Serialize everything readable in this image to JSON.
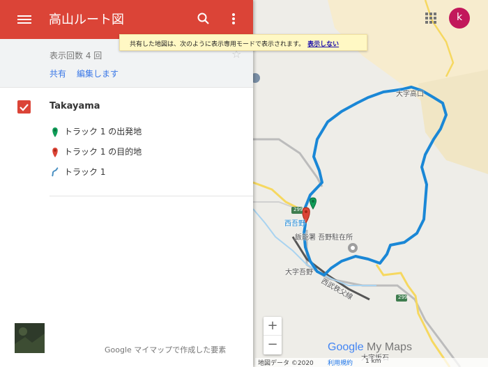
{
  "header": {
    "title": "高山ルート図",
    "menu_icon": "menu-icon",
    "search_icon": "search-icon",
    "more_icon": "more-vert-icon"
  },
  "info": {
    "views": "表示回数 4 回",
    "share_label": "共有",
    "edit_label": "編集します"
  },
  "layer": {
    "name": "Takayama",
    "checked": true,
    "features": [
      {
        "label": "トラック 1 の出発地",
        "icon": "green-pin-icon",
        "color": "#0f9d58"
      },
      {
        "label": "トラック 1 の目的地",
        "icon": "red-pin-icon",
        "color": "#db4437"
      },
      {
        "label": "トラック 1",
        "icon": "route-line-icon",
        "color": "#4a90c2"
      }
    ]
  },
  "footer": {
    "made_with": "Google マイマップで作成した要素"
  },
  "notice": {
    "text": "共有した地図は、次のように表示専用モードで表示されます。",
    "link": "表示しない"
  },
  "avatar": {
    "letter": "k",
    "color": "#c2185b"
  },
  "map": {
    "labels": {
      "oaza_takaguri": "大字高口",
      "nishi_agano": "西吾野",
      "police": "飯能署 吾野駐在所",
      "oaza_agano": "大字吾野",
      "railway": "西武秩父線",
      "road_299_a": "299",
      "road_299_b": "299",
      "oaza_bottom": "大字坂石"
    },
    "route_color": "#1a87d6",
    "brand_google": "Google",
    "brand_mymaps": "My Maps",
    "attribution": "地図データ ©2020",
    "terms": "利用規約",
    "scale": "1 km"
  },
  "zoom": {
    "in": "+",
    "out": "−"
  }
}
